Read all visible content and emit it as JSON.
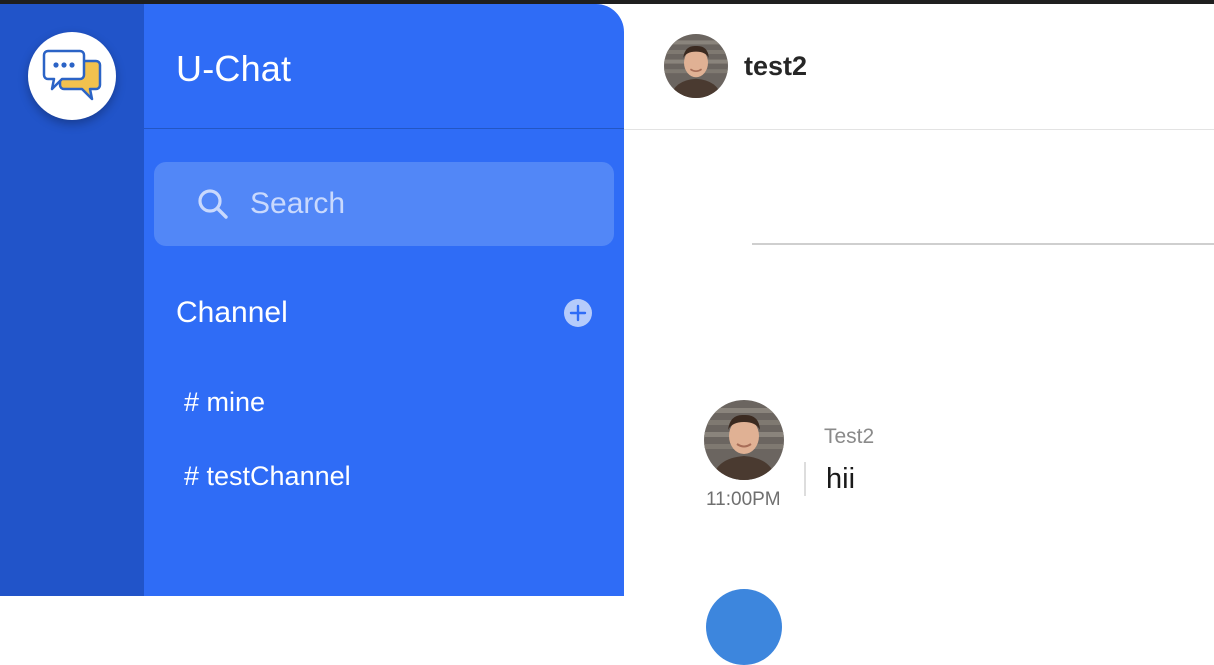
{
  "app": {
    "title": "U-Chat"
  },
  "search": {
    "placeholder": "Search",
    "value": ""
  },
  "channels": {
    "heading": "Channel",
    "items": [
      {
        "label": "# mine"
      },
      {
        "label": "# testChannel"
      }
    ]
  },
  "chat": {
    "header": {
      "username": "test2"
    },
    "messages": [
      {
        "sender": "Test2",
        "time": "11:00PM",
        "text": "hii"
      }
    ]
  },
  "colors": {
    "rail": "#2154c9",
    "sidebar": "#2f6cf6",
    "search_box": "#5287f7",
    "logo_bubble_front": "#2b63c6",
    "logo_bubble_back": "#f2c14e"
  },
  "icons": {
    "logo": "chat-bubbles-icon",
    "search": "search-icon",
    "add": "plus-circle-icon"
  }
}
